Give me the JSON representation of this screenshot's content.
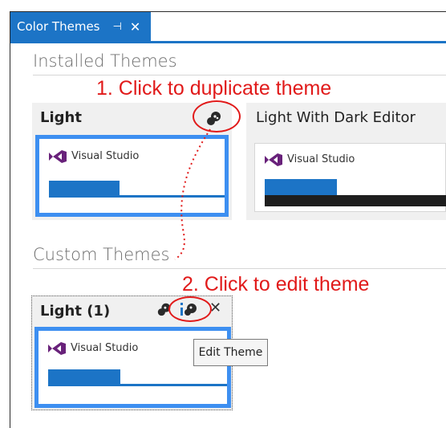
{
  "window": {
    "tab_title": "Color Themes",
    "tab_pin": "⊣",
    "tab_close": "✕"
  },
  "installed": {
    "section_title": "Installed Themes",
    "themes": [
      {
        "name": "Light",
        "preview_label": "Visual Studio"
      },
      {
        "name": "Light With Dark Editor",
        "preview_label": "Visual Studio"
      }
    ]
  },
  "custom": {
    "section_title": "Custom Themes",
    "themes": [
      {
        "name": "Light (1)",
        "preview_label": "Visual Studio",
        "close": "✕"
      }
    ]
  },
  "annotations": {
    "step1": "1. Click to duplicate theme",
    "step2": "2. Click to edit theme"
  },
  "tooltip": "Edit Theme",
  "colors": {
    "accent": "#1c74c6",
    "selected_border": "#3d8ff1",
    "annotation": "#e11a1a",
    "vs_purple": "#68217a",
    "dark_bar": "#1e1e1e"
  },
  "icons": {
    "duplicate": "duplicate-theme-icon",
    "edit": "edit-theme-icon",
    "close": "close-icon",
    "vs_logo": "visual-studio-logo-icon"
  }
}
